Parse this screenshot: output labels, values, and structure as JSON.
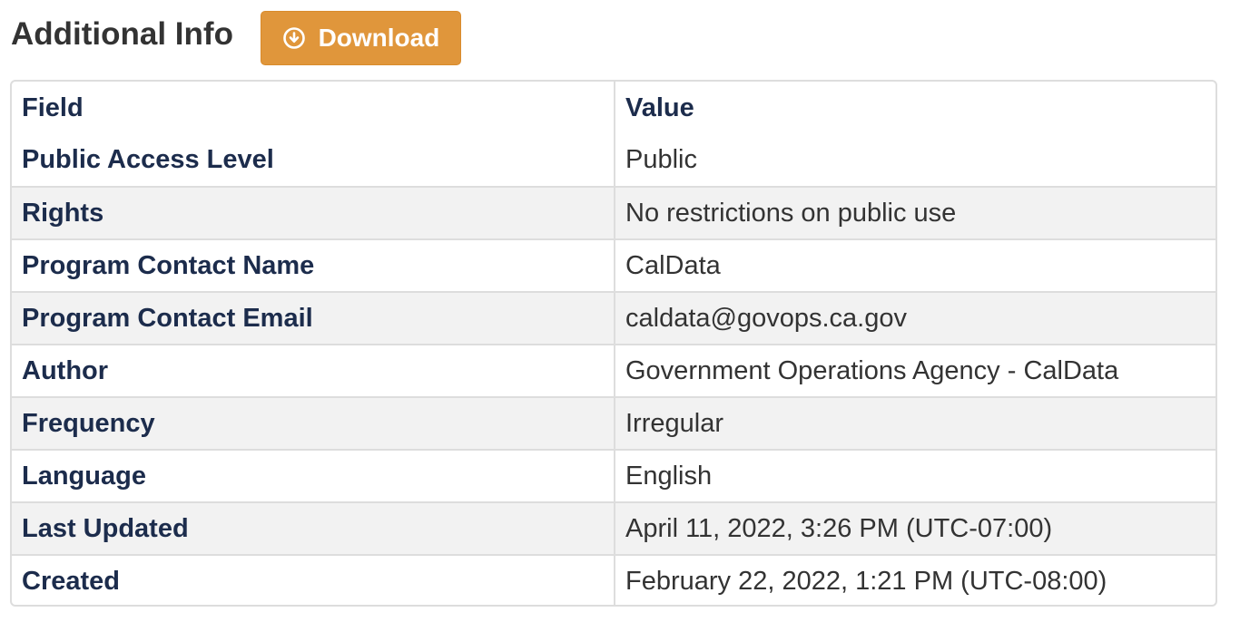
{
  "header": {
    "title": "Additional Info",
    "download_label": "Download",
    "download_icon": "download-circle-icon",
    "download_color": "#e0963b"
  },
  "table": {
    "columns": [
      "Field",
      "Value"
    ],
    "rows": [
      {
        "field": "Public Access Level",
        "value": "Public"
      },
      {
        "field": "Rights",
        "value": "No restrictions on public use"
      },
      {
        "field": "Program Contact Name",
        "value": "CalData"
      },
      {
        "field": "Program Contact Email",
        "value": "caldata@govops.ca.gov"
      },
      {
        "field": "Author",
        "value": "Government Operations Agency - CalData"
      },
      {
        "field": "Frequency",
        "value": "Irregular"
      },
      {
        "field": "Language",
        "value": "English"
      },
      {
        "field": "Last Updated",
        "value": "April 11, 2022, 3:26 PM (UTC-07:00)"
      },
      {
        "field": "Created",
        "value": "February 22, 2022, 1:21 PM (UTC-08:00)"
      }
    ]
  }
}
